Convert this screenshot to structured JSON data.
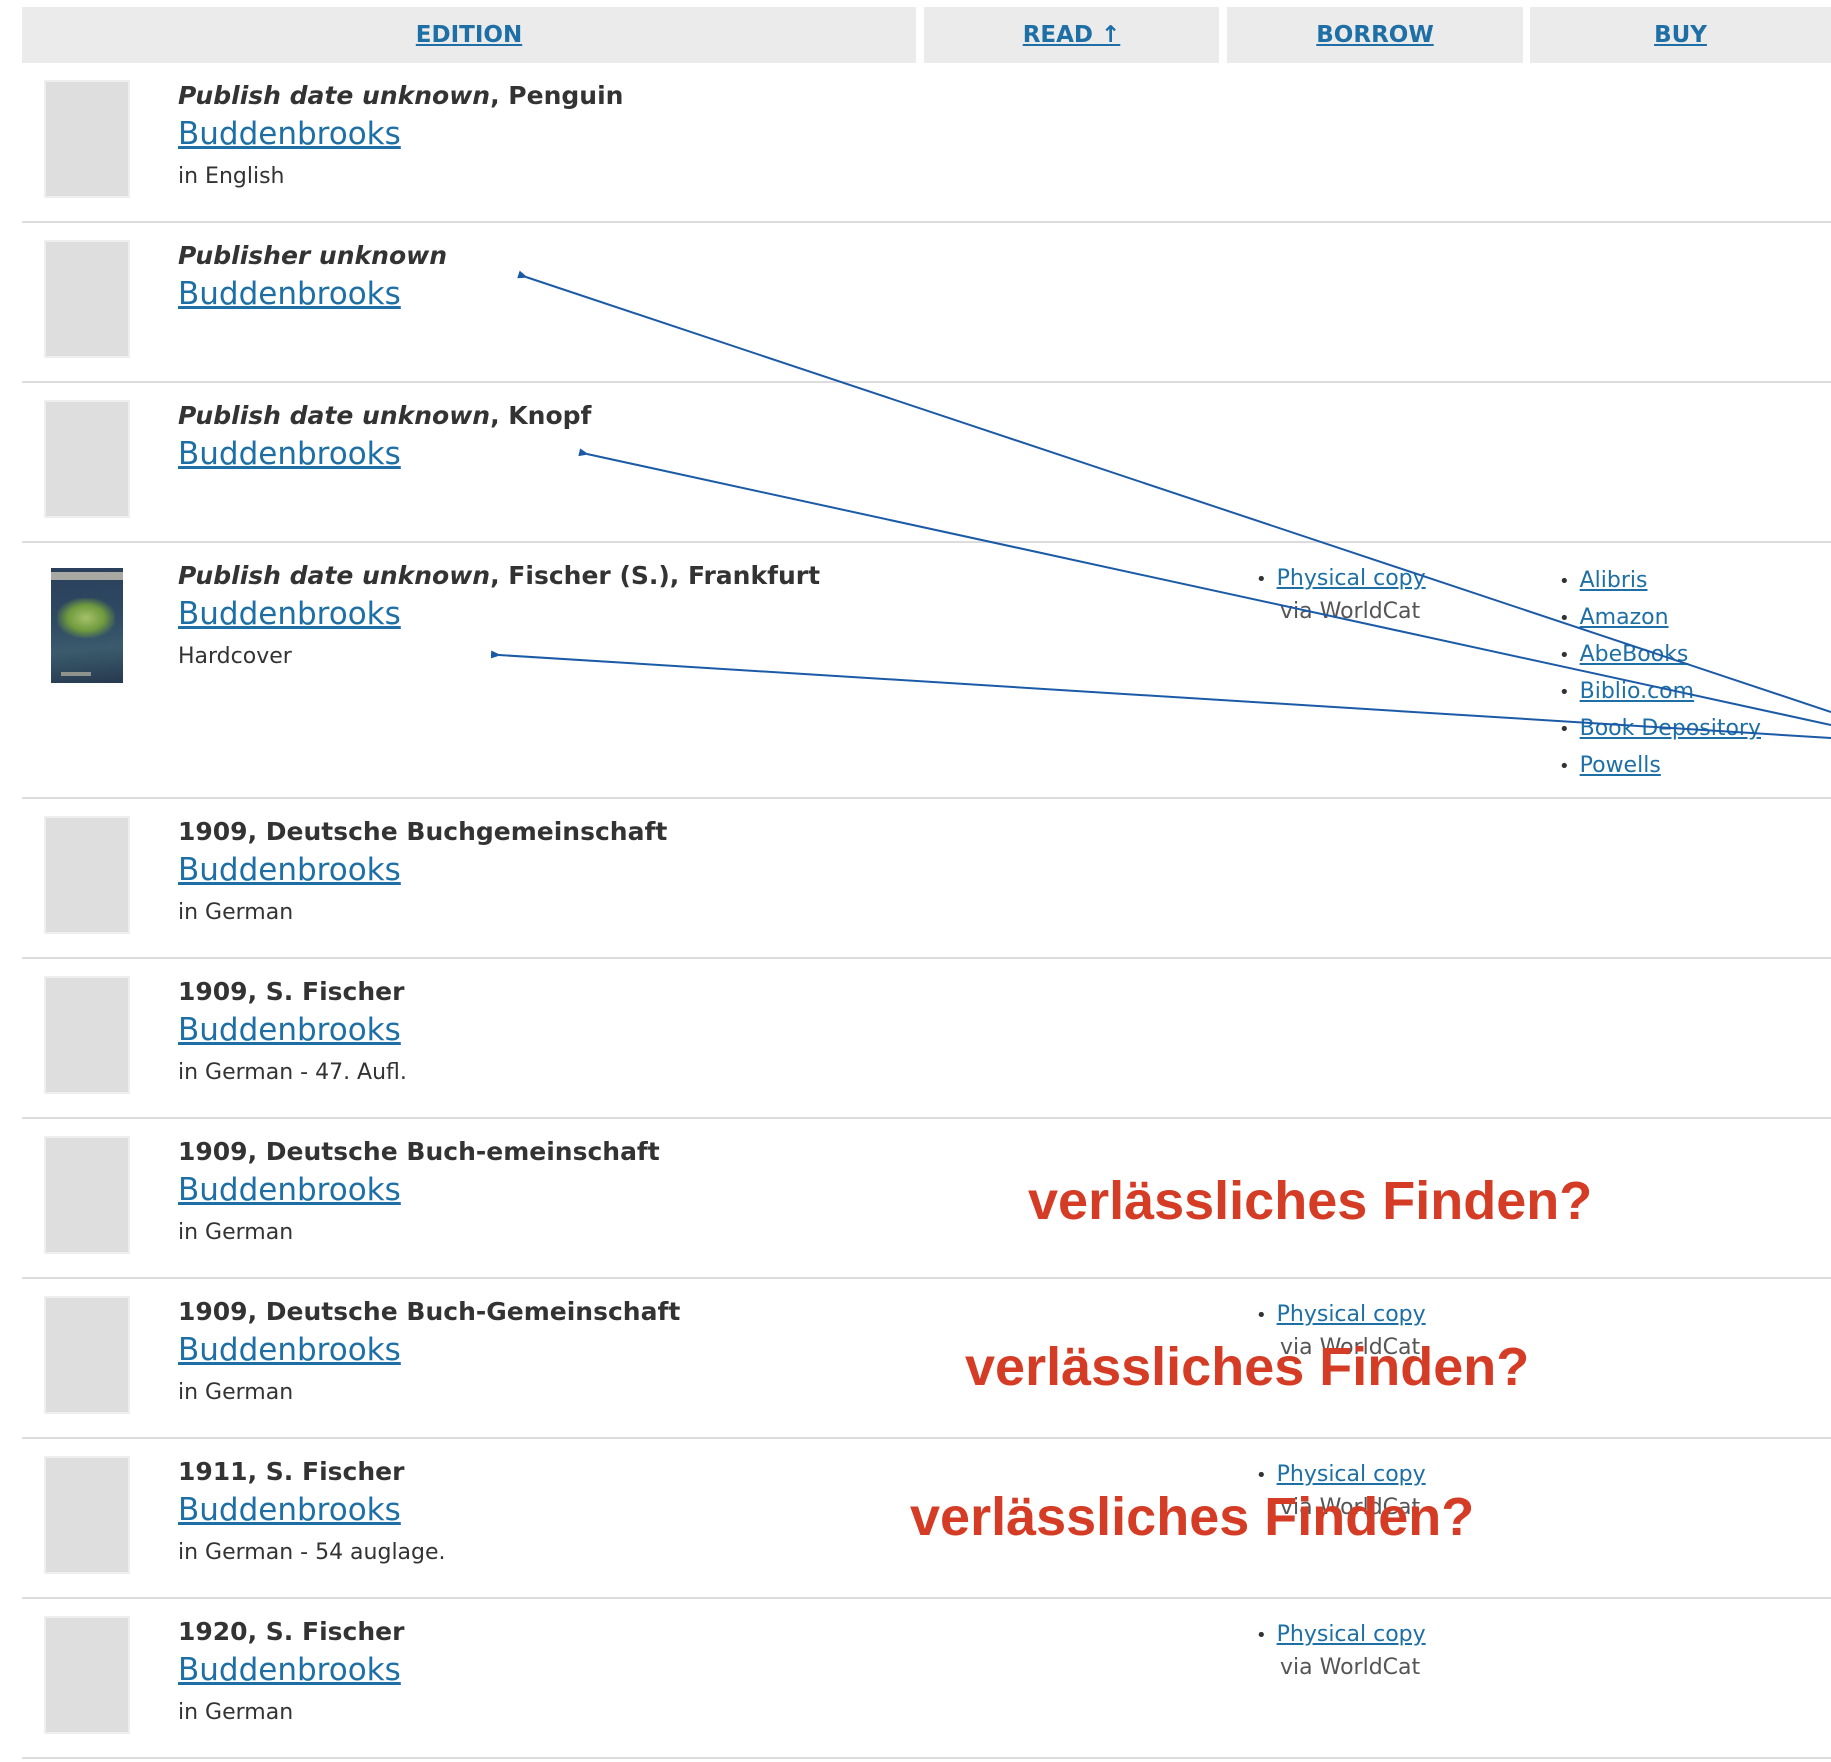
{
  "header": {
    "edition": "EDITION",
    "read": "READ ↑",
    "borrow": "BORROW",
    "buy": "BUY"
  },
  "rows": [
    {
      "date": "Publish date unknown",
      "publisher": ", Penguin",
      "title": "Buddenbrooks",
      "sub": "in English"
    },
    {
      "date": "Publisher unknown",
      "publisher": "",
      "title": "Buddenbrooks",
      "sub": ""
    },
    {
      "date": "Publish date unknown",
      "publisher": ", Knopf",
      "title": "Buddenbrooks",
      "sub": ""
    },
    {
      "date": "Publish date unknown",
      "publisher": ", Fischer (S.), Frankfurt",
      "title": "Buddenbrooks",
      "sub": "Hardcover"
    },
    {
      "date": "",
      "publisher": "1909, Deutsche Buchgemeinschaft",
      "title": "Buddenbrooks",
      "sub": "in German"
    },
    {
      "date": "",
      "publisher": "1909, S. Fischer",
      "title": "Buddenbrooks",
      "sub": "in German - 47. Aufl."
    },
    {
      "date": "",
      "publisher": "1909, Deutsche Buch-emeinschaft",
      "title": "Buddenbrooks",
      "sub": "in German"
    },
    {
      "date": "",
      "publisher": "1909, Deutsche Buch-Gemeinschaft",
      "title": "Buddenbrooks",
      "sub": "in German"
    },
    {
      "date": "",
      "publisher": "1911, S. Fischer",
      "title": "Buddenbrooks",
      "sub": "in German - 54 auglage."
    },
    {
      "date": "",
      "publisher": "1920, S. Fischer",
      "title": "Buddenbrooks",
      "sub": "in German"
    }
  ],
  "borrow": {
    "physical_copy": "Physical copy",
    "via": "via WorldCat"
  },
  "buy_links": [
    "Alibris",
    "Amazon",
    "AbeBooks",
    "Biblio.com",
    "Book Depository",
    "Powells"
  ],
  "overlay_text": "verlässliches Finden?",
  "colors": {
    "link": "#1d6fa5",
    "overlay": "#d43c26",
    "arrow": "#1a5aa6",
    "header_bg": "#ebebeb"
  },
  "icons": {
    "cover_placeholder": "book-cover-placeholder",
    "cover_image": "book-cover-image"
  }
}
